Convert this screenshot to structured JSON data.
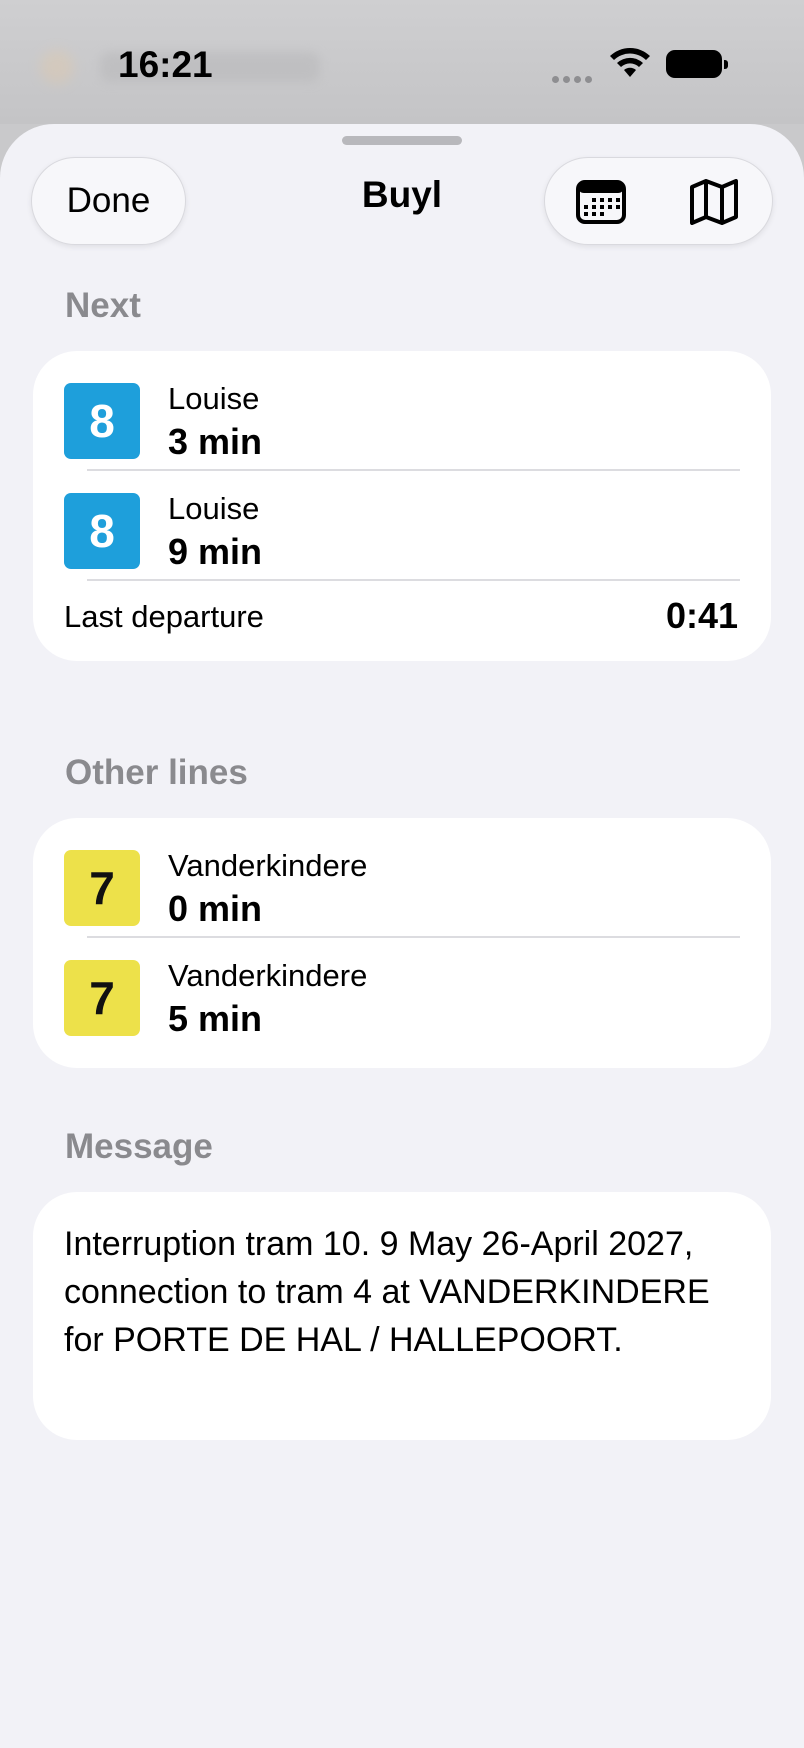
{
  "status": {
    "time": "16:21"
  },
  "header": {
    "done_label": "Done",
    "title": "Buyl",
    "calendar_icon": "calendar-icon",
    "map_icon": "map-icon"
  },
  "next": {
    "label": "Next",
    "rows": [
      {
        "line": "8",
        "color": "#1e9fdb",
        "destination": "Louise",
        "time": "3 min"
      },
      {
        "line": "8",
        "color": "#1e9fdb",
        "destination": "Louise",
        "time": "9 min"
      }
    ],
    "last_departure_label": "Last departure",
    "last_departure_value": "0:41"
  },
  "other": {
    "label": "Other lines",
    "rows": [
      {
        "line": "7",
        "color": "#ede14a",
        "destination": "Vanderkindere",
        "time": "0 min"
      },
      {
        "line": "7",
        "color": "#ede14a",
        "destination": "Vanderkindere",
        "time": "5 min"
      }
    ]
  },
  "message": {
    "label": "Message",
    "text": "Interruption tram 10. 9 May 26-April 2027, connection to tram 4 at VANDERKINDERE for PORTE DE HAL / HALLEPOORT."
  }
}
